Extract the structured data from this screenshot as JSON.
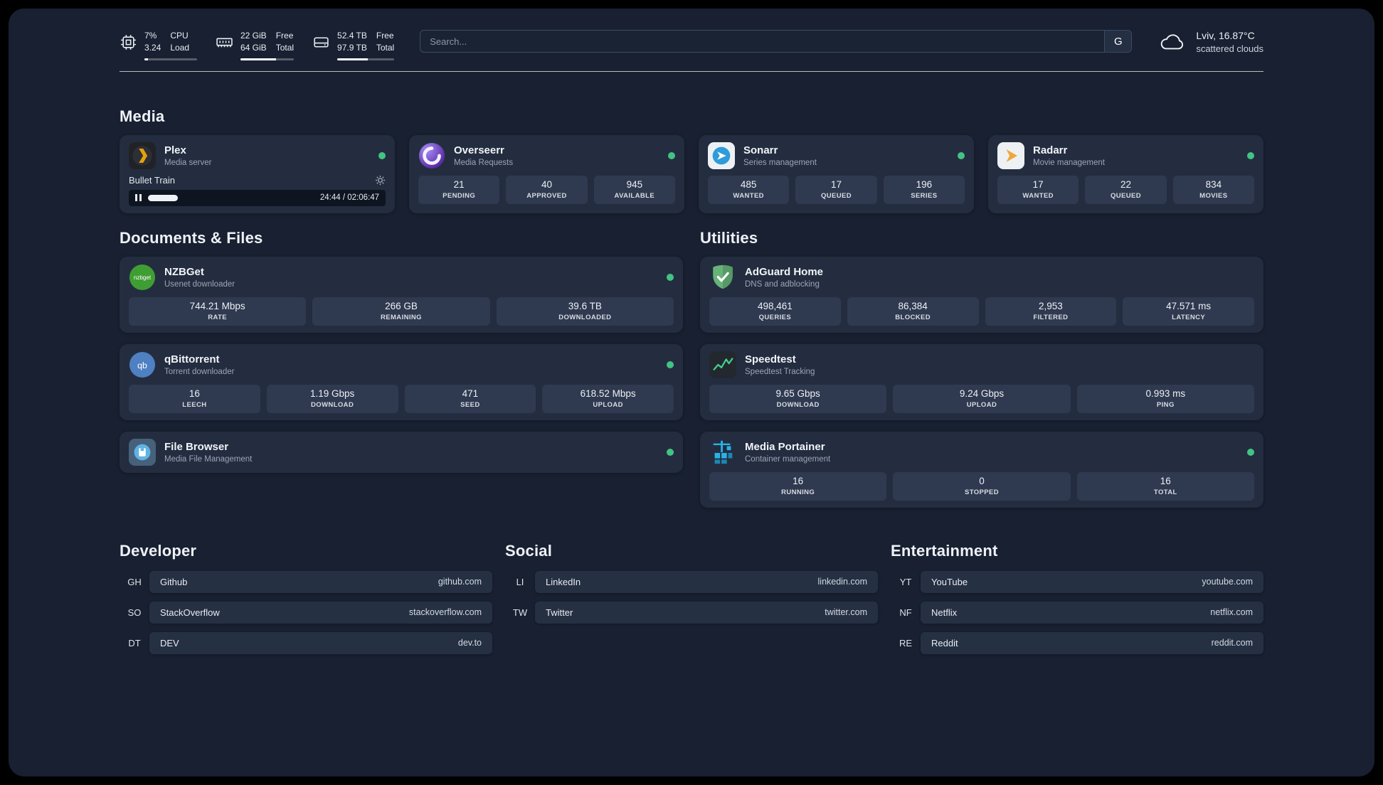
{
  "header": {
    "cpu": {
      "value_top": "7%",
      "value_bottom": "3.24",
      "label_top": "CPU",
      "label_bottom": "Load",
      "usage_percent": 7
    },
    "ram": {
      "value_top": "22 GiB",
      "value_bottom": "64 GiB",
      "label_top": "Free",
      "label_bottom": "Total",
      "usage_percent": 66
    },
    "disk": {
      "value_top": "52.4 TB",
      "value_bottom": "97.9 TB",
      "label_top": "Free",
      "label_bottom": "Total",
      "usage_percent": 54
    },
    "search": {
      "placeholder": "Search...",
      "button_label": "G"
    },
    "weather": {
      "location": "Lviv, 16.87°C",
      "condition": "scattered clouds"
    }
  },
  "sections": {
    "media": "Media",
    "documents": "Documents & Files",
    "utilities": "Utilities",
    "developer": "Developer",
    "social": "Social",
    "entertainment": "Entertainment"
  },
  "apps": {
    "plex": {
      "name": "Plex",
      "subtitle": "Media server",
      "now_playing": {
        "title": "Bullet Train",
        "time": "24:44 / 02:06:47",
        "progress_percent": 18
      }
    },
    "overseerr": {
      "name": "Overseerr",
      "subtitle": "Media Requests",
      "stats": [
        {
          "value": "21",
          "label": "PENDING"
        },
        {
          "value": "40",
          "label": "APPROVED"
        },
        {
          "value": "945",
          "label": "AVAILABLE"
        }
      ]
    },
    "sonarr": {
      "name": "Sonarr",
      "subtitle": "Series management",
      "stats": [
        {
          "value": "485",
          "label": "WANTED"
        },
        {
          "value": "17",
          "label": "QUEUED"
        },
        {
          "value": "196",
          "label": "SERIES"
        }
      ]
    },
    "radarr": {
      "name": "Radarr",
      "subtitle": "Movie management",
      "stats": [
        {
          "value": "17",
          "label": "WANTED"
        },
        {
          "value": "22",
          "label": "QUEUED"
        },
        {
          "value": "834",
          "label": "MOVIES"
        }
      ]
    },
    "nzbget": {
      "name": "NZBGet",
      "subtitle": "Usenet downloader",
      "icon_text": "nzbget",
      "stats": [
        {
          "value": "744.21 Mbps",
          "label": "RATE"
        },
        {
          "value": "266 GB",
          "label": "REMAINING"
        },
        {
          "value": "39.6 TB",
          "label": "DOWNLOADED"
        }
      ]
    },
    "qbittorrent": {
      "name": "qBittorrent",
      "subtitle": "Torrent downloader",
      "icon_text": "qb",
      "stats": [
        {
          "value": "16",
          "label": "LEECH"
        },
        {
          "value": "1.19 Gbps",
          "label": "DOWNLOAD"
        },
        {
          "value": "471",
          "label": "SEED"
        },
        {
          "value": "618.52 Mbps",
          "label": "UPLOAD"
        }
      ]
    },
    "filebrowser": {
      "name": "File Browser",
      "subtitle": "Media File Management"
    },
    "adguard": {
      "name": "AdGuard Home",
      "subtitle": "DNS and adblocking",
      "stats": [
        {
          "value": "498,461",
          "label": "QUERIES"
        },
        {
          "value": "86,384",
          "label": "BLOCKED"
        },
        {
          "value": "2,953",
          "label": "FILTERED"
        },
        {
          "value": "47.571 ms",
          "label": "LATENCY"
        }
      ]
    },
    "speedtest": {
      "name": "Speedtest",
      "subtitle": "Speedtest Tracking",
      "stats": [
        {
          "value": "9.65 Gbps",
          "label": "DOWNLOAD"
        },
        {
          "value": "9.24 Gbps",
          "label": "UPLOAD"
        },
        {
          "value": "0.993 ms",
          "label": "PING"
        }
      ]
    },
    "portainer": {
      "name": "Media Portainer",
      "subtitle": "Container management",
      "stats": [
        {
          "value": "16",
          "label": "RUNNING"
        },
        {
          "value": "0",
          "label": "STOPPED"
        },
        {
          "value": "16",
          "label": "TOTAL"
        }
      ]
    }
  },
  "links": {
    "developer": [
      {
        "abbr": "GH",
        "name": "Github",
        "url": "github.com"
      },
      {
        "abbr": "SO",
        "name": "StackOverflow",
        "url": "stackoverflow.com"
      },
      {
        "abbr": "DT",
        "name": "DEV",
        "url": "dev.to"
      }
    ],
    "social": [
      {
        "abbr": "LI",
        "name": "LinkedIn",
        "url": "linkedin.com"
      },
      {
        "abbr": "TW",
        "name": "Twitter",
        "url": "twitter.com"
      }
    ],
    "entertainment": [
      {
        "abbr": "YT",
        "name": "YouTube",
        "url": "youtube.com"
      },
      {
        "abbr": "NF",
        "name": "Netflix",
        "url": "netflix.com"
      },
      {
        "abbr": "RE",
        "name": "Reddit",
        "url": "reddit.com"
      }
    ]
  },
  "colors": {
    "status_online": "#43c383"
  }
}
